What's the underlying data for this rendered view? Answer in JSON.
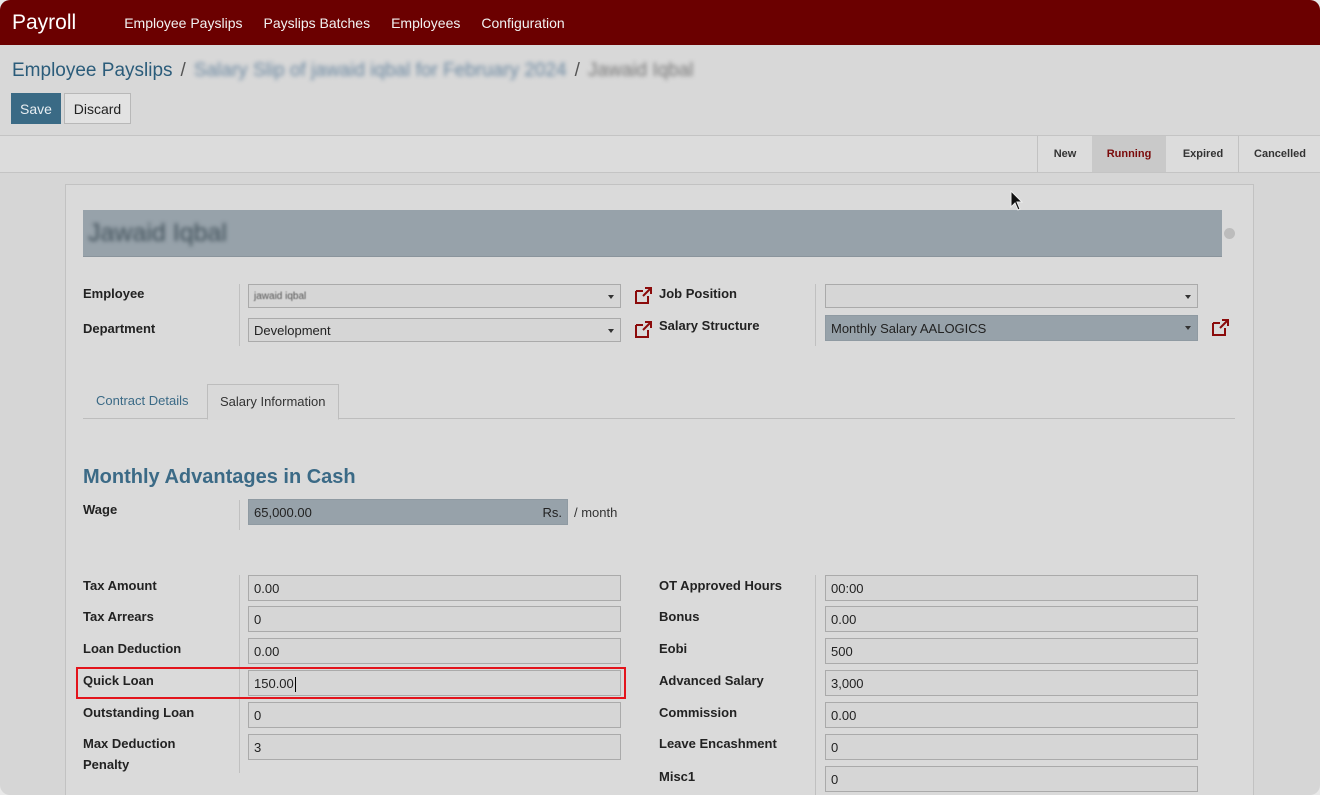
{
  "navbar": {
    "brand": "Payroll",
    "items": [
      "Employee Payslips",
      "Payslips Batches",
      "Employees",
      "Configuration"
    ]
  },
  "breadcrumb": {
    "root": "Employee Payslips",
    "middle": "Salary Slip of jawaid iqbal for February 2024",
    "current": "Jawaid Iqbal",
    "separator": "/"
  },
  "actions": {
    "save": "Save",
    "discard": "Discard"
  },
  "status": {
    "stages": [
      "New",
      "Running",
      "Expired",
      "Cancelled"
    ],
    "active": "Running"
  },
  "form": {
    "name": "Jawaid Iqbal",
    "employee_label": "Employee",
    "employee_value": "jawaid iqbal",
    "department_label": "Department",
    "department_value": "Development",
    "job_position_label": "Job Position",
    "job_position_value": "",
    "salary_structure_label": "Salary Structure",
    "salary_structure_value": "Monthly Salary AALOGICS"
  },
  "tabs": [
    "Contract Details",
    "Salary Information"
  ],
  "active_tab": "Salary Information",
  "section": {
    "title": "Monthly Advantages in Cash",
    "wage_label": "Wage",
    "wage_value": "65,000.00",
    "currency": "Rs.",
    "per": "/ month"
  },
  "left_fields": [
    {
      "label": "Tax Amount",
      "value": "0.00"
    },
    {
      "label": "Tax Arrears",
      "value": "0"
    },
    {
      "label": "Loan Deduction",
      "value": "0.00"
    },
    {
      "label": "Quick Loan",
      "value": "150.00"
    },
    {
      "label": "Outstanding Loan",
      "value": "0"
    },
    {
      "label": "Max Deduction",
      "label2": "Penalty",
      "value": "3"
    }
  ],
  "right_fields": [
    {
      "label": "OT Approved Hours",
      "value": "00:00"
    },
    {
      "label": "Bonus",
      "value": "0.00"
    },
    {
      "label": "Eobi",
      "value": "500"
    },
    {
      "label": "Advanced Salary",
      "value": "3,000"
    },
    {
      "label": "Commission",
      "value": "0.00"
    },
    {
      "label": "Leave Encashment",
      "value": "0"
    },
    {
      "label": "Misc1",
      "value": "0"
    }
  ],
  "colors": {
    "navbar": "#6b0000",
    "accent": "#3b6a86",
    "highlight": "#e3141c"
  }
}
